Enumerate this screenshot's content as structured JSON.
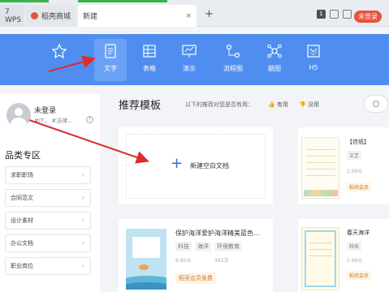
{
  "tabs": {
    "wps": "7 WPS",
    "store": "稻壳商城",
    "new": "新建",
    "close": "×",
    "add": "+"
  },
  "toolbar": {
    "icons": [
      "window-icon",
      "skin-icon",
      "minimize-icon"
    ],
    "window_number": "1",
    "login": "未登录"
  },
  "ribbon": {
    "items": [
      {
        "label": "",
        "icon": "star-icon"
      },
      {
        "label": "文字",
        "icon": "document-icon"
      },
      {
        "label": "表格",
        "icon": "table-icon"
      },
      {
        "label": "演示",
        "icon": "presentation-icon"
      },
      {
        "label": "流程图",
        "icon": "flowchart-icon"
      },
      {
        "label": "脑图",
        "icon": "mindmap-icon"
      },
      {
        "label": "H5",
        "icon": "h5-icon"
      }
    ],
    "accent": "#4f8ef0"
  },
  "user": {
    "name": "未登录",
    "tags": "#IT、 #法律...",
    "help": "?"
  },
  "categories": {
    "title": "品类专区",
    "items": [
      "求职职场",
      "合同范文",
      "设计素材",
      "办公文档",
      "职业岗位"
    ],
    "arrow": "›"
  },
  "main": {
    "title": "推荐模板",
    "question": "以下的推荐对您是否有用：",
    "useful": "👍 有用",
    "useless": "👎 没用",
    "blank_plus": "+",
    "blank_label": "新建空白文档"
  },
  "templates": {
    "letter": {
      "title": "【信纸】",
      "tags": [
        "文艺"
      ],
      "meta": "2.99元",
      "vip": "稻壳会员"
    },
    "ocean": {
      "title": "保护海洋爱护海洋精美蓝色...",
      "tags": [
        "科技",
        "海洋",
        "环保教育"
      ],
      "price": "9.90元",
      "downloads": "363次",
      "vip": "稻壳会员免费"
    },
    "spring": {
      "title": "春天海洋",
      "tags": [
        "科技"
      ],
      "meta": "2.99元",
      "vip": "稻壳会员"
    }
  }
}
